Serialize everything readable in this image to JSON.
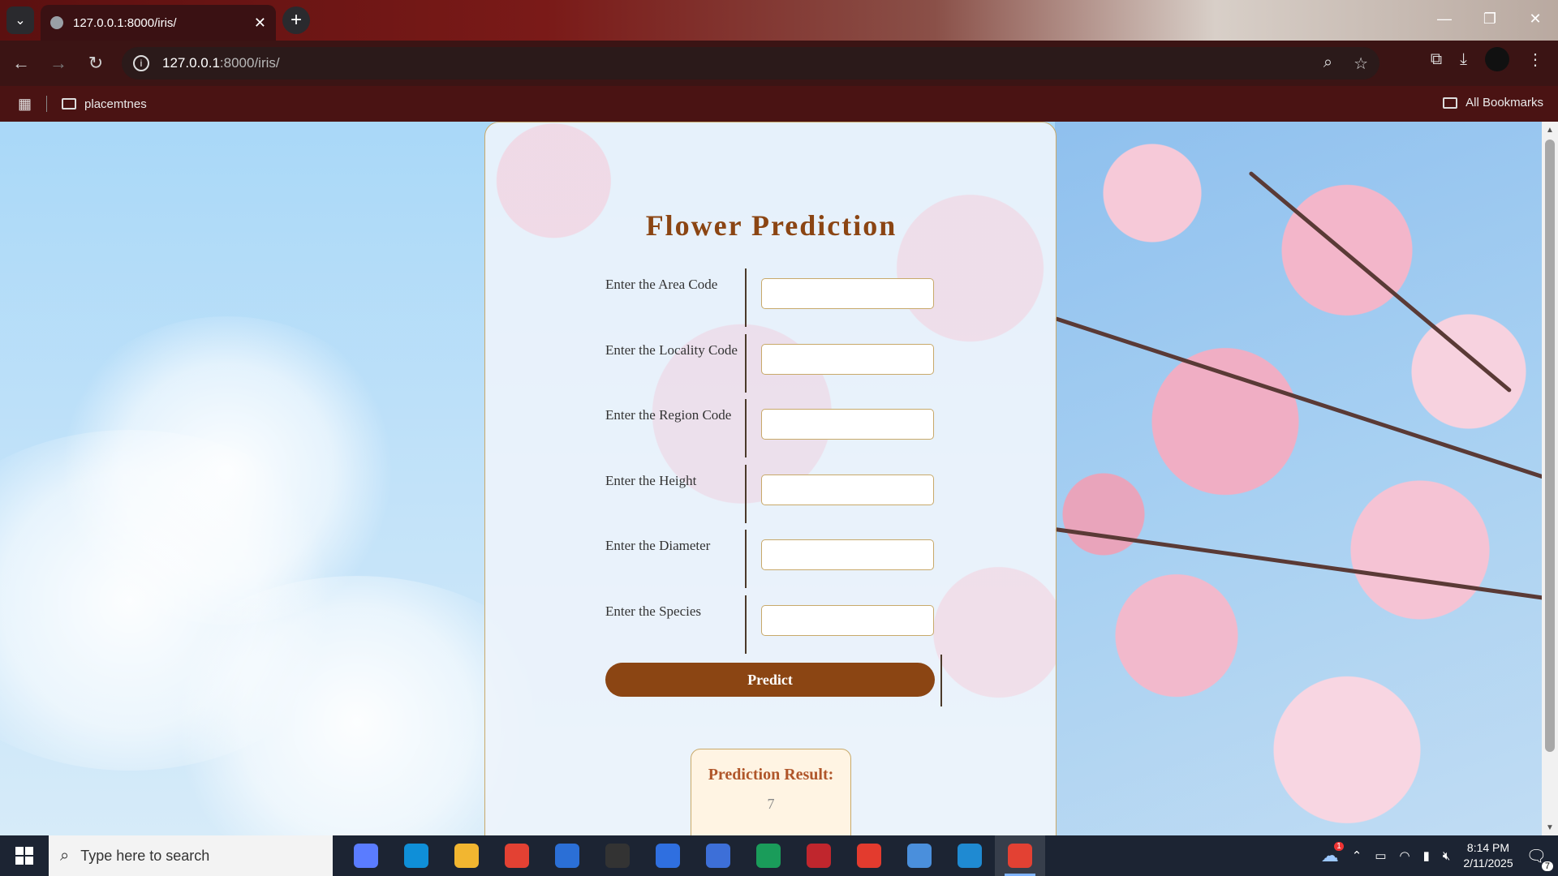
{
  "browser": {
    "tab_title": "127.0.0.1:8000/iris/",
    "url_host": "127.0.0.1",
    "url_path": ":8000/iris/",
    "bookmark_folder": "placemtnes",
    "all_bookmarks": "All Bookmarks"
  },
  "page": {
    "title": "Flower Prediction",
    "fields": [
      {
        "label": "Enter the Area Code",
        "value": ""
      },
      {
        "label": "Enter the Locality Code",
        "value": ""
      },
      {
        "label": "Enter the Region Code",
        "value": ""
      },
      {
        "label": "Enter the Height",
        "value": ""
      },
      {
        "label": "Enter the Diameter",
        "value": ""
      },
      {
        "label": "Enter the Species",
        "value": ""
      }
    ],
    "predict_label": "Predict",
    "result_title": "Prediction Result:",
    "result_value": "7"
  },
  "taskbar": {
    "search_placeholder": "Type here to search",
    "time": "8:14 PM",
    "date": "2/11/2025",
    "notification_count": "7",
    "weather_badge": "1",
    "apps": [
      {
        "name": "copilot",
        "color": "#5a7cff"
      },
      {
        "name": "edge",
        "color": "#0f8fd8"
      },
      {
        "name": "file-explorer",
        "color": "#f2b630"
      },
      {
        "name": "chrome",
        "color": "#e34133"
      },
      {
        "name": "ccleaner",
        "color": "#2b6fd6"
      },
      {
        "name": "github",
        "color": "#333333"
      },
      {
        "name": "app-a",
        "color": "#2f6fe0"
      },
      {
        "name": "intellij",
        "color": "#3d6fd8"
      },
      {
        "name": "pycharm",
        "color": "#1a9c5a"
      },
      {
        "name": "red-app",
        "color": "#c0262d"
      },
      {
        "name": "wps",
        "color": "#e33b2e"
      },
      {
        "name": "vs-installer",
        "color": "#4a8fdc"
      },
      {
        "name": "vscode",
        "color": "#1f8ad2"
      },
      {
        "name": "chrome-active",
        "color": "#e34133"
      }
    ]
  }
}
